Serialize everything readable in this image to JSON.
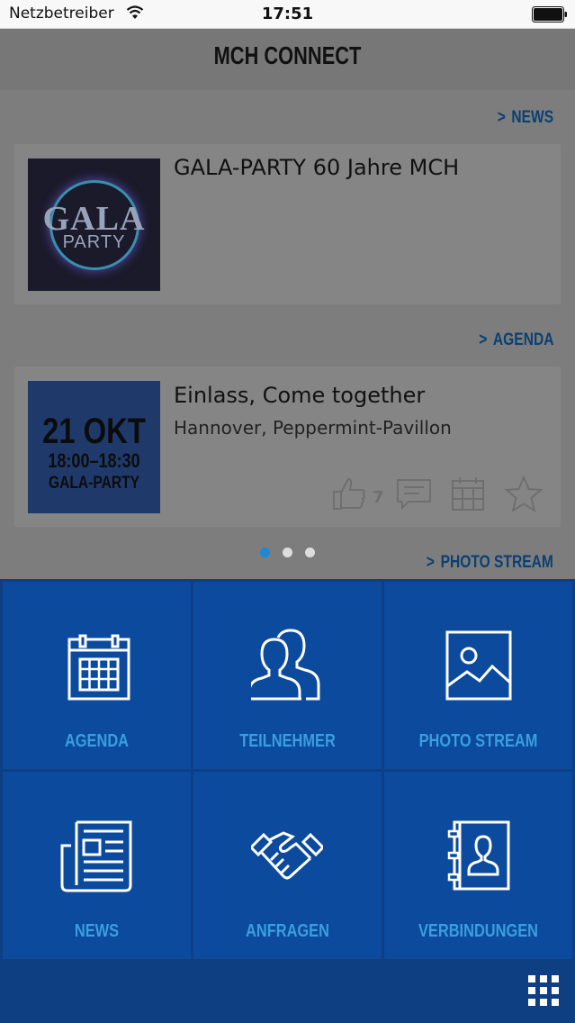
{
  "status_bar": {
    "carrier": "Netzbetreiber",
    "time": "17:51"
  },
  "header": {
    "title": "MCH CONNECT"
  },
  "sections": {
    "news_link": "NEWS",
    "agenda_link": "AGENDA",
    "photo_link": "PHOTO STREAM"
  },
  "news_card": {
    "title": "GALA-PARTY 60 Jahre MCH",
    "image_text_top": "GALA",
    "image_text_bottom": "PARTY"
  },
  "agenda_card": {
    "title": "Einlass, Come together",
    "location": "Hannover, Peppermint-Pavillon",
    "date_day": "21 OKT",
    "date_time": "18:00–18:30",
    "date_event": "GALA-PARTY",
    "like_count": "7"
  },
  "carousel": {
    "pages": 3,
    "active": 0
  },
  "menu": {
    "tiles": [
      {
        "label": "AGENDA",
        "icon": "calendar-icon"
      },
      {
        "label": "TEILNEHMER",
        "icon": "participants-icon"
      },
      {
        "label": "PHOTO STREAM",
        "icon": "photo-icon"
      },
      {
        "label": "NEWS",
        "icon": "newspaper-icon"
      },
      {
        "label": "ANFRAGEN",
        "icon": "handshake-icon"
      },
      {
        "label": "VERBINDUNGEN",
        "icon": "contacts-book-icon"
      }
    ]
  },
  "colors": {
    "accent": "#3a9ee0",
    "tile_bg": "#0b4a9c",
    "grid_bg": "#0e3f82",
    "link": "#0b3f72"
  }
}
